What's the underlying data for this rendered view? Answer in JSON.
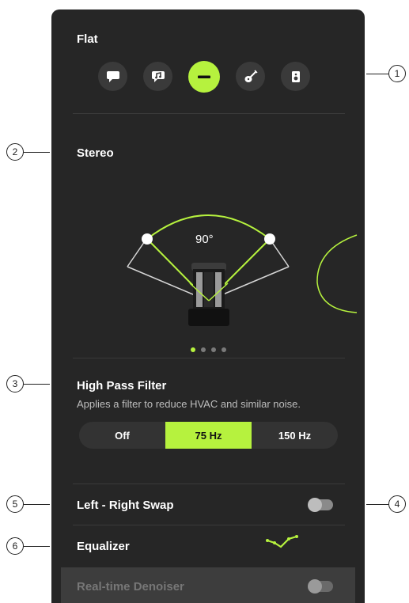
{
  "preset": {
    "title": "Flat",
    "icons": [
      "speech-bubble-icon",
      "music-note-bubble-icon",
      "flat-icon",
      "guitar-icon",
      "speaker-icon"
    ],
    "active_index": 2
  },
  "stereo": {
    "title": "Stereo",
    "angle_label": "90°",
    "page_count": 4,
    "active_page": 0
  },
  "high_pass_filter": {
    "title": "High Pass Filter",
    "description": "Applies a filter to reduce HVAC and similar noise.",
    "options": [
      "Off",
      "75 Hz",
      "150 Hz"
    ],
    "selected_index": 1
  },
  "left_right_swap": {
    "label": "Left - Right Swap",
    "enabled": false
  },
  "equalizer": {
    "label": "Equalizer",
    "icon": "eq-curve-icon"
  },
  "denoiser": {
    "label": "Real-time Denoiser",
    "enabled": false
  },
  "callouts": [
    "1",
    "2",
    "3",
    "4",
    "5",
    "6"
  ],
  "colors": {
    "accent": "#b6f23e",
    "panel_bg": "#262626",
    "button_bg": "#3a3a3a",
    "muted_text": "#bdbdbd"
  }
}
